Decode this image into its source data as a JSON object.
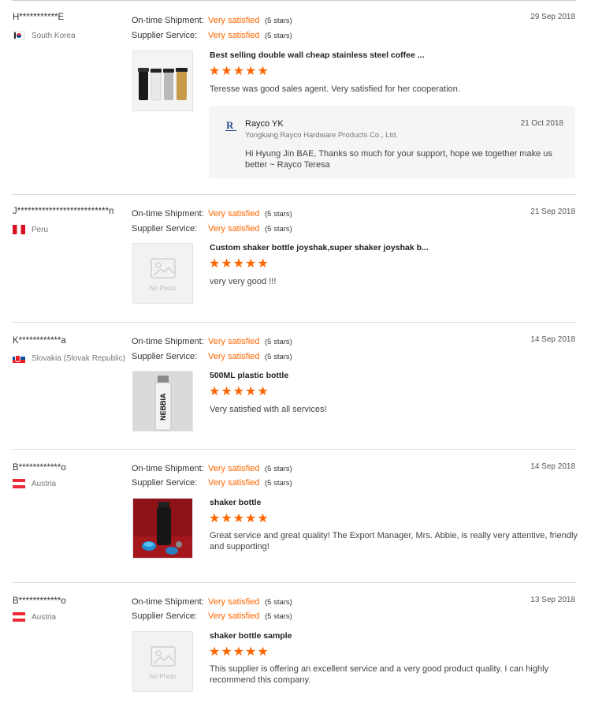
{
  "labels": {
    "ontime": "On-time Shipment:",
    "supplier": "Supplier Service:",
    "no_photo": "No Photo"
  },
  "colors": {
    "accent": "#ff6600",
    "divider": "#dcdcdc",
    "reply_bg": "#f5f5f5"
  },
  "reviews": [
    {
      "buyer": "H***********E",
      "country": "South Korea",
      "flag": "flag-kr",
      "date": "29 Sep 2018",
      "ontime_value": "Very satisfied",
      "ontime_stars": "(5 stars)",
      "supplier_value": "Very satisfied",
      "supplier_stars": "(5 stars)",
      "product": "Best selling double wall cheap stainless steel coffee ...",
      "rating": 5,
      "comment": "Teresse was good sales agent. Very satisfied for her cooperation.",
      "image": "cups-photo",
      "reply": {
        "name": "Rayco YK",
        "company": "Yongkang Rayco Hardware Products Co., Ltd.",
        "date": "21 Oct 2018",
        "text": "Hi Hyung Jin BAE, Thanks so much for your support, hope we together make us better ~ Rayco Teresa"
      }
    },
    {
      "buyer": "J**************************n",
      "country": "Peru",
      "flag": "flag-pe",
      "date": "21 Sep 2018",
      "ontime_value": "Very satisfied",
      "ontime_stars": "(5 stars)",
      "supplier_value": "Very satisfied",
      "supplier_stars": "(5 stars)",
      "product": "Custom shaker bottle joyshak,super shaker joyshak b...",
      "rating": 5,
      "comment": "very very good !!!",
      "image": "no-photo"
    },
    {
      "buyer": "K************a",
      "country": "Slovakia (Slovak Republic)",
      "flag": "flag-sk",
      "date": "14 Sep 2018",
      "ontime_value": "Very satisfied",
      "ontime_stars": "(5 stars)",
      "supplier_value": "Very satisfied",
      "supplier_stars": "(5 stars)",
      "product": "500ML plastic bottle",
      "rating": 5,
      "comment": "Very satisfied with all services!",
      "image": "bottle-photo",
      "image_text": "NEBBIA"
    },
    {
      "buyer": "B************o",
      "country": "Austria",
      "flag": "flag-at",
      "date": "14 Sep 2018",
      "ontime_value": "Very satisfied",
      "ontime_stars": "(5 stars)",
      "supplier_value": "Very satisfied",
      "supplier_stars": "(5 stars)",
      "product": "shaker bottle",
      "rating": 5,
      "comment": "Great service and great quality! The Export Manager, Mrs. Abbie, is really very attentive, friendly and supporting!",
      "image": "shaker-photo"
    },
    {
      "buyer": "B************o",
      "country": "Austria",
      "flag": "flag-at",
      "date": "13 Sep 2018",
      "ontime_value": "Very satisfied",
      "ontime_stars": "(5 stars)",
      "supplier_value": "Very satisfied",
      "supplier_stars": "(5 stars)",
      "product": "shaker bottle sample",
      "rating": 5,
      "comment": "This supplier is offering an excellent service and a very good product quality. I can highly recommend this company.",
      "image": "no-photo"
    }
  ]
}
